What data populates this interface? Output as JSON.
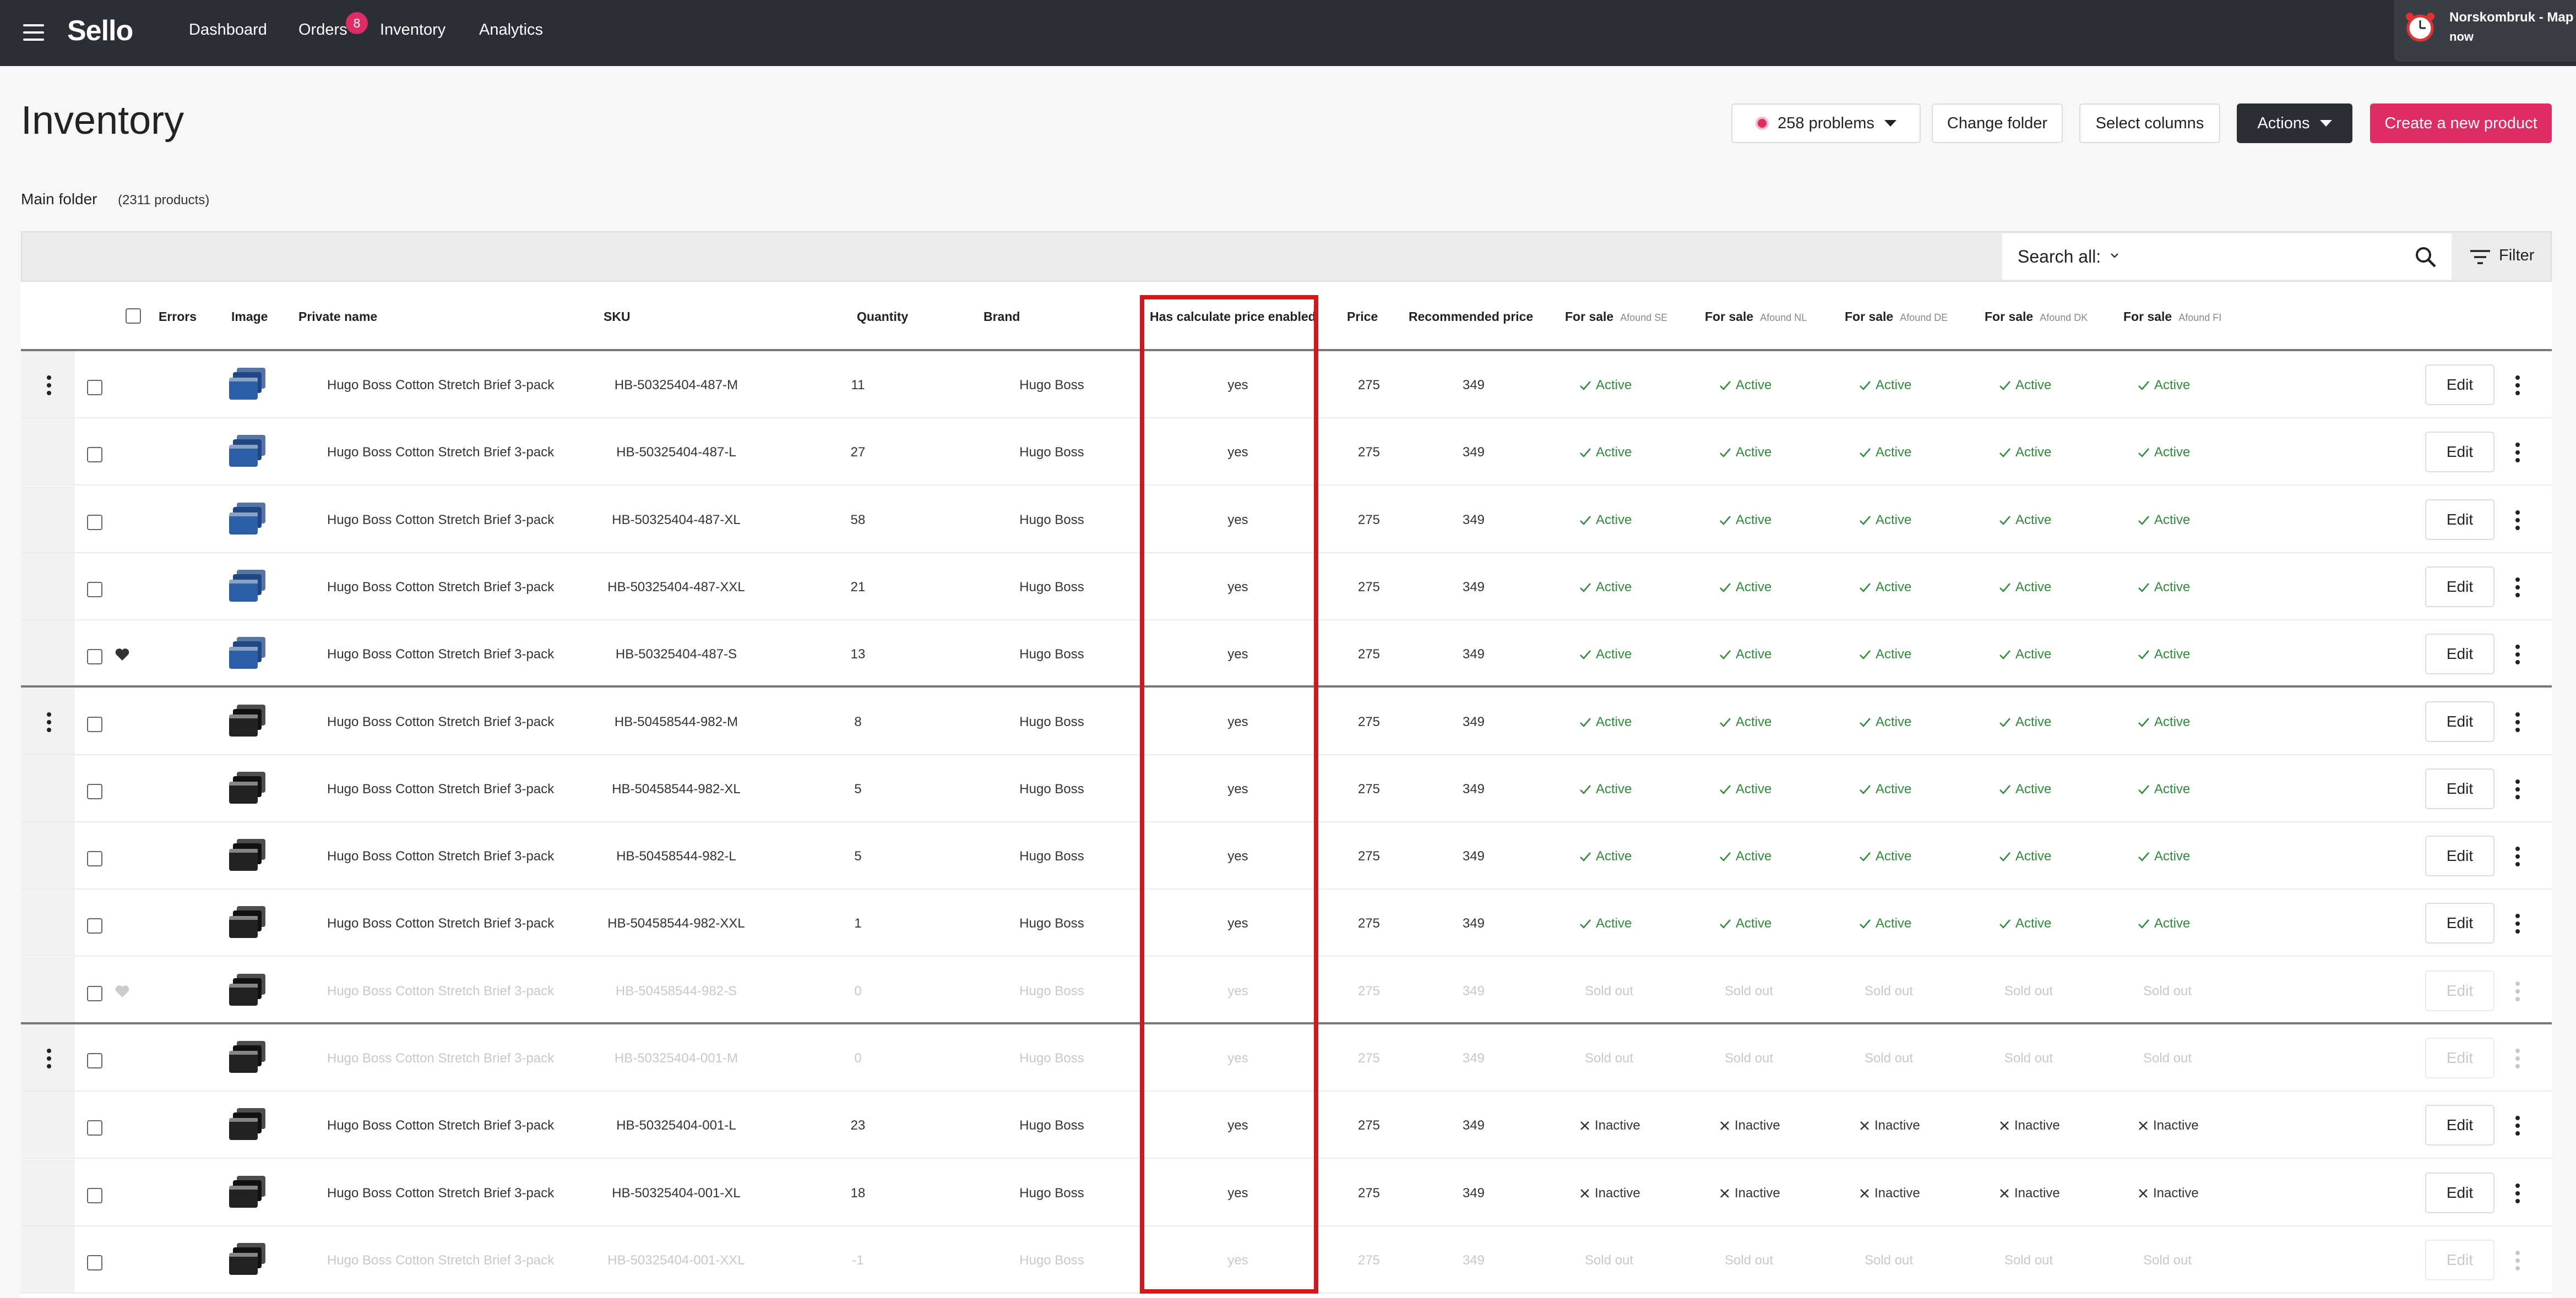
{
  "nav": {
    "logo": "Sello",
    "links": [
      "Dashboard",
      "Orders",
      "Inventory",
      "Analytics"
    ],
    "orders_badge": "8"
  },
  "notification": {
    "title": "Norskombruk - Map",
    "time": "now"
  },
  "page": {
    "title": "Inventory",
    "problems_label": "258 problems",
    "change_folder": "Change folder",
    "select_columns": "Select columns",
    "actions": "Actions",
    "create_product": "Create a new product",
    "folder_name": "Main folder",
    "folder_count": "(2311 products)"
  },
  "search": {
    "label": "Search all:",
    "filter": "Filter"
  },
  "columns": {
    "errors": "Errors",
    "image": "Image",
    "private_name": "Private name",
    "sku": "SKU",
    "quantity": "Quantity",
    "brand": "Brand",
    "calc": "Has calculate price enabled",
    "price": "Price",
    "recommended": "Recommended price",
    "for_sale": "For sale",
    "markets": [
      "Afound SE",
      "Afound NL",
      "Afound DE",
      "Afound DK",
      "Afound FI"
    ]
  },
  "edit_label": "Edit",
  "status_labels": {
    "active": "Active",
    "inactive": "Inactive",
    "sold": "Sold out"
  },
  "colors": {
    "nav": "#2b2d37",
    "accent": "#dd2d62",
    "active": "#2e8b3a",
    "highlight": "#d11919"
  },
  "rows": [
    {
      "name": "Hugo Boss Cotton Stretch Brief 3-pack",
      "sku": "HB-50325404-487-M",
      "qty": "11",
      "brand": "Hugo Boss",
      "calc": "yes",
      "price": "275",
      "rec": "349",
      "status": "active",
      "thumb": "blue",
      "heart": "",
      "dim": false,
      "group_start": true,
      "group_end": false
    },
    {
      "name": "Hugo Boss Cotton Stretch Brief 3-pack",
      "sku": "HB-50325404-487-L",
      "qty": "27",
      "brand": "Hugo Boss",
      "calc": "yes",
      "price": "275",
      "rec": "349",
      "status": "active",
      "thumb": "blue",
      "heart": "",
      "dim": false,
      "group_start": false,
      "group_end": false
    },
    {
      "name": "Hugo Boss Cotton Stretch Brief 3-pack",
      "sku": "HB-50325404-487-XL",
      "qty": "58",
      "brand": "Hugo Boss",
      "calc": "yes",
      "price": "275",
      "rec": "349",
      "status": "active",
      "thumb": "blue",
      "heart": "",
      "dim": false,
      "group_start": false,
      "group_end": false
    },
    {
      "name": "Hugo Boss Cotton Stretch Brief 3-pack",
      "sku": "HB-50325404-487-XXL",
      "qty": "21",
      "brand": "Hugo Boss",
      "calc": "yes",
      "price": "275",
      "rec": "349",
      "status": "active",
      "thumb": "blue",
      "heart": "",
      "dim": false,
      "group_start": false,
      "group_end": false
    },
    {
      "name": "Hugo Boss Cotton Stretch Brief 3-pack",
      "sku": "HB-50325404-487-S",
      "qty": "13",
      "brand": "Hugo Boss",
      "calc": "yes",
      "price": "275",
      "rec": "349",
      "status": "active",
      "thumb": "blue",
      "heart": "dark",
      "dim": false,
      "group_start": false,
      "group_end": true
    },
    {
      "name": "Hugo Boss Cotton Stretch Brief 3-pack",
      "sku": "HB-50458544-982-M",
      "qty": "8",
      "brand": "Hugo Boss",
      "calc": "yes",
      "price": "275",
      "rec": "349",
      "status": "active",
      "thumb": "black",
      "heart": "",
      "dim": false,
      "group_start": true,
      "group_end": false
    },
    {
      "name": "Hugo Boss Cotton Stretch Brief 3-pack",
      "sku": "HB-50458544-982-XL",
      "qty": "5",
      "brand": "Hugo Boss",
      "calc": "yes",
      "price": "275",
      "rec": "349",
      "status": "active",
      "thumb": "black",
      "heart": "",
      "dim": false,
      "group_start": false,
      "group_end": false
    },
    {
      "name": "Hugo Boss Cotton Stretch Brief 3-pack",
      "sku": "HB-50458544-982-L",
      "qty": "5",
      "brand": "Hugo Boss",
      "calc": "yes",
      "price": "275",
      "rec": "349",
      "status": "active",
      "thumb": "black",
      "heart": "",
      "dim": false,
      "group_start": false,
      "group_end": false
    },
    {
      "name": "Hugo Boss Cotton Stretch Brief 3-pack",
      "sku": "HB-50458544-982-XXL",
      "qty": "1",
      "brand": "Hugo Boss",
      "calc": "yes",
      "price": "275",
      "rec": "349",
      "status": "active",
      "thumb": "black",
      "heart": "",
      "dim": false,
      "group_start": false,
      "group_end": false
    },
    {
      "name": "Hugo Boss Cotton Stretch Brief 3-pack",
      "sku": "HB-50458544-982-S",
      "qty": "0",
      "brand": "Hugo Boss",
      "calc": "yes",
      "price": "275",
      "rec": "349",
      "status": "sold",
      "thumb": "black",
      "heart": "light",
      "dim": true,
      "group_start": false,
      "group_end": true
    },
    {
      "name": "Hugo Boss Cotton Stretch Brief 3-pack",
      "sku": "HB-50325404-001-M",
      "qty": "0",
      "brand": "Hugo Boss",
      "calc": "yes",
      "price": "275",
      "rec": "349",
      "status": "sold",
      "thumb": "black",
      "heart": "",
      "dim": true,
      "group_start": true,
      "group_end": false
    },
    {
      "name": "Hugo Boss Cotton Stretch Brief 3-pack",
      "sku": "HB-50325404-001-L",
      "qty": "23",
      "brand": "Hugo Boss",
      "calc": "yes",
      "price": "275",
      "rec": "349",
      "status": "inactive",
      "thumb": "black",
      "heart": "",
      "dim": false,
      "group_start": false,
      "group_end": false
    },
    {
      "name": "Hugo Boss Cotton Stretch Brief 3-pack",
      "sku": "HB-50325404-001-XL",
      "qty": "18",
      "brand": "Hugo Boss",
      "calc": "yes",
      "price": "275",
      "rec": "349",
      "status": "inactive",
      "thumb": "black",
      "heart": "",
      "dim": false,
      "group_start": false,
      "group_end": false
    },
    {
      "name": "Hugo Boss Cotton Stretch Brief 3-pack",
      "sku": "HB-50325404-001-XXL",
      "qty": "-1",
      "brand": "Hugo Boss",
      "calc": "yes",
      "price": "275",
      "rec": "349",
      "status": "sold",
      "thumb": "black",
      "heart": "",
      "dim": true,
      "group_start": false,
      "group_end": false
    }
  ]
}
